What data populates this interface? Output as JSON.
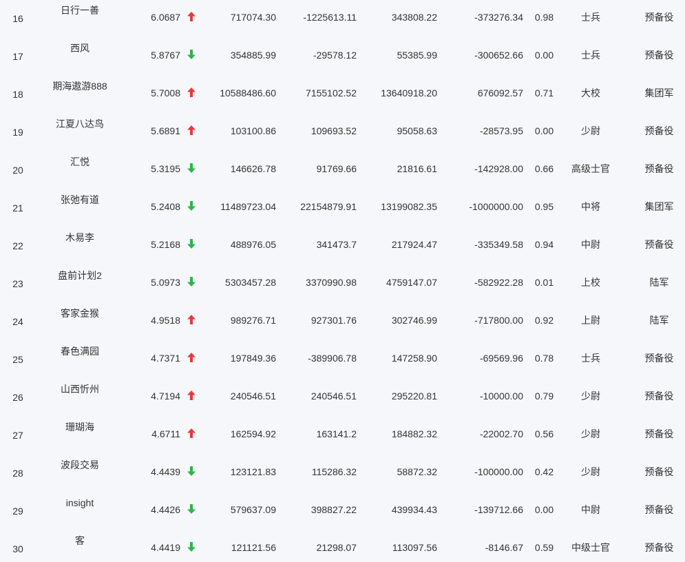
{
  "colors": {
    "up": "#e8393d",
    "down": "#2db54c",
    "text": "#333333",
    "background": "#f5f7fa"
  },
  "rows": [
    {
      "rank": "16",
      "name": "日行一善",
      "score": "6.0687",
      "trend": "up",
      "v1": "717074.30",
      "v2": "-1225613.11",
      "v3": "343808.22",
      "v4": "-373276.34",
      "ratio": "0.98",
      "title": "士兵",
      "group": "预备役"
    },
    {
      "rank": "17",
      "name": "西风",
      "score": "5.8767",
      "trend": "down",
      "v1": "354885.99",
      "v2": "-29578.12",
      "v3": "55385.99",
      "v4": "-300652.66",
      "ratio": "0.00",
      "title": "士兵",
      "group": "预备役"
    },
    {
      "rank": "18",
      "name": "期海遨游888",
      "score": "5.7008",
      "trend": "up",
      "v1": "10588486.60",
      "v2": "7155102.52",
      "v3": "13640918.20",
      "v4": "676092.57",
      "ratio": "0.71",
      "title": "大校",
      "group": "集团军"
    },
    {
      "rank": "19",
      "name": "江夏八达鸟",
      "score": "5.6891",
      "trend": "up",
      "v1": "103100.86",
      "v2": "109693.52",
      "v3": "95058.63",
      "v4": "-28573.95",
      "ratio": "0.00",
      "title": "少尉",
      "group": "预备役"
    },
    {
      "rank": "20",
      "name": "汇悦",
      "score": "5.3195",
      "trend": "down",
      "v1": "146626.78",
      "v2": "91769.66",
      "v3": "21816.61",
      "v4": "-142928.00",
      "ratio": "0.66",
      "title": "高级士官",
      "group": "预备役"
    },
    {
      "rank": "21",
      "name": "张弛有道",
      "score": "5.2408",
      "trend": "down",
      "v1": "11489723.04",
      "v2": "22154879.91",
      "v3": "13199082.35",
      "v4": "-1000000.00",
      "ratio": "0.95",
      "title": "中将",
      "group": "集团军"
    },
    {
      "rank": "22",
      "name": "木易李",
      "score": "5.2168",
      "trend": "down",
      "v1": "488976.05",
      "v2": "341473.7",
      "v3": "217924.47",
      "v4": "-335349.58",
      "ratio": "0.94",
      "title": "中尉",
      "group": "预备役"
    },
    {
      "rank": "23",
      "name": "盘前计划2",
      "score": "5.0973",
      "trend": "down",
      "v1": "5303457.28",
      "v2": "3370990.98",
      "v3": "4759147.07",
      "v4": "-582922.28",
      "ratio": "0.01",
      "title": "上校",
      "group": "陆军"
    },
    {
      "rank": "24",
      "name": "客家金猴",
      "score": "4.9518",
      "trend": "up",
      "v1": "989276.71",
      "v2": "927301.76",
      "v3": "302746.99",
      "v4": "-717800.00",
      "ratio": "0.92",
      "title": "上尉",
      "group": "陆军"
    },
    {
      "rank": "25",
      "name": "春色满园",
      "score": "4.7371",
      "trend": "up",
      "v1": "197849.36",
      "v2": "-389906.78",
      "v3": "147258.90",
      "v4": "-69569.96",
      "ratio": "0.78",
      "title": "士兵",
      "group": "预备役"
    },
    {
      "rank": "26",
      "name": "山西忻州",
      "score": "4.7194",
      "trend": "up",
      "v1": "240546.51",
      "v2": "240546.51",
      "v3": "295220.81",
      "v4": "-10000.00",
      "ratio": "0.79",
      "title": "少尉",
      "group": "预备役"
    },
    {
      "rank": "27",
      "name": "珊瑚海",
      "score": "4.6711",
      "trend": "up",
      "v1": "162594.92",
      "v2": "163141.2",
      "v3": "184882.32",
      "v4": "-22002.70",
      "ratio": "0.56",
      "title": "少尉",
      "group": "预备役"
    },
    {
      "rank": "28",
      "name": "波段交易",
      "score": "4.4439",
      "trend": "down",
      "v1": "123121.83",
      "v2": "115286.32",
      "v3": "58872.32",
      "v4": "-100000.00",
      "ratio": "0.42",
      "title": "少尉",
      "group": "预备役"
    },
    {
      "rank": "29",
      "name": "insight",
      "score": "4.4426",
      "trend": "down",
      "v1": "579637.09",
      "v2": "398827.22",
      "v3": "439934.43",
      "v4": "-139712.66",
      "ratio": "0.00",
      "title": "中尉",
      "group": "预备役"
    },
    {
      "rank": "30",
      "name": "客",
      "score": "4.4419",
      "trend": "down",
      "v1": "121121.56",
      "v2": "21298.07",
      "v3": "113097.56",
      "v4": "-8146.67",
      "ratio": "0.59",
      "title": "中级士官",
      "group": "预备役"
    }
  ]
}
